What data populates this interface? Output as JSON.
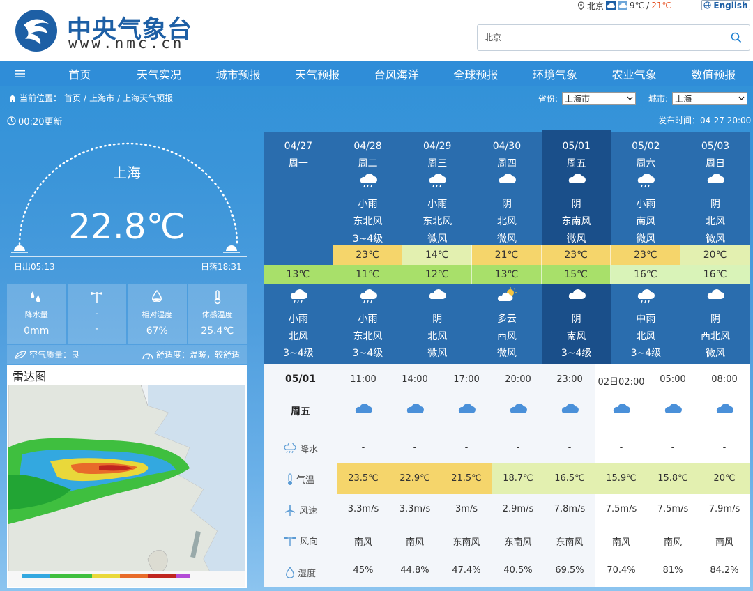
{
  "header": {
    "site_name": "中央气象台",
    "site_url": "www.nmc.cn",
    "top_city": "北京",
    "top_temp_low": "9℃",
    "top_sep": "/",
    "top_temp_high": "21℃",
    "english_label": "English",
    "search_value": "北京"
  },
  "nav": {
    "items": [
      "首页",
      "天气实况",
      "城市预报",
      "天气预报",
      "台风海洋",
      "全球预报",
      "环境气象",
      "农业气象",
      "数值预报"
    ]
  },
  "breadcrumb": {
    "prefix": "当前位置：",
    "items": [
      "首页",
      "上海市",
      "上海天气预报"
    ],
    "sep": "/"
  },
  "selectors": {
    "province_label": "省份:",
    "province_value": "上海市",
    "city_label": "城市:",
    "city_value": "上海"
  },
  "status": {
    "update": "00:20更新",
    "publish": "发布时间：04-27 20:00"
  },
  "current": {
    "city": "上海",
    "temp": "22.8℃",
    "sunrise": "日出05:13",
    "sunset": "日落18:31"
  },
  "stats": [
    {
      "icon": "raindrops-icon",
      "label": "降水量",
      "value": "0mm"
    },
    {
      "icon": "wind-vane-icon",
      "label": "-",
      "value": "-"
    },
    {
      "icon": "humidity-icon",
      "label": "相对湿度",
      "value": "67%"
    },
    {
      "icon": "thermometer-icon",
      "label": "体感温度",
      "value": "25.4℃"
    }
  ],
  "air": {
    "quality": "空气质量：良",
    "comfort": "舒适度：温暖，较舒适"
  },
  "radar": {
    "title": "雷达图"
  },
  "forecast": [
    {
      "date": "04/27",
      "week": "周一",
      "day_weather": "",
      "day_wind_dir": "",
      "day_wind_level": "",
      "high": "",
      "low": "13℃",
      "night_icon": "cloud-rain-icon",
      "night_weather": "小雨",
      "night_wind_dir": "北风",
      "night_wind_level": "3~4级"
    },
    {
      "date": "04/28",
      "week": "周二",
      "day_icon": "cloud-rain-icon",
      "day_weather": "小雨",
      "day_wind_dir": "东北风",
      "day_wind_level": "3~4级",
      "high": "23℃",
      "low": "11℃",
      "night_icon": "cloud-rain-icon",
      "night_weather": "小雨",
      "night_wind_dir": "东北风",
      "night_wind_level": "3~4级"
    },
    {
      "date": "04/29",
      "week": "周三",
      "day_icon": "cloud-rain-icon",
      "day_weather": "小雨",
      "day_wind_dir": "东北风",
      "day_wind_level": "微风",
      "high": "14℃",
      "low": "12℃",
      "night_icon": "cloud-icon",
      "night_weather": "阴",
      "night_wind_dir": "北风",
      "night_wind_level": "微风"
    },
    {
      "date": "04/30",
      "week": "周四",
      "day_icon": "cloud-icon",
      "day_weather": "阴",
      "day_wind_dir": "北风",
      "day_wind_level": "微风",
      "high": "21℃",
      "low": "13℃",
      "night_icon": "partly-cloudy-icon",
      "night_weather": "多云",
      "night_wind_dir": "西风",
      "night_wind_level": "微风"
    },
    {
      "date": "05/01",
      "week": "周五",
      "day_icon": "cloud-icon",
      "day_weather": "阴",
      "day_wind_dir": "东南风",
      "day_wind_level": "微风",
      "high": "23℃",
      "low": "15℃",
      "night_icon": "cloud-icon",
      "night_weather": "阴",
      "night_wind_dir": "南风",
      "night_wind_level": "3~4级"
    },
    {
      "date": "05/02",
      "week": "周六",
      "day_icon": "cloud-rain-icon",
      "day_weather": "小雨",
      "day_wind_dir": "南风",
      "day_wind_level": "微风",
      "high": "23℃",
      "low": "16℃",
      "night_icon": "cloud-rain-icon",
      "night_weather": "中雨",
      "night_wind_dir": "北风",
      "night_wind_level": "3~4级"
    },
    {
      "date": "05/03",
      "week": "周日",
      "day_icon": "cloud-icon",
      "day_weather": "阴",
      "day_wind_dir": "北风",
      "day_wind_level": "微风",
      "high": "20℃",
      "low": "16℃",
      "night_icon": "cloud-icon",
      "night_weather": "阴",
      "night_wind_dir": "西北风",
      "night_wind_level": "微风"
    }
  ],
  "hourly": {
    "date": "05/01",
    "week": "周五",
    "labels": {
      "precip": "降水",
      "temp": "气温",
      "wind_speed": "风速",
      "wind_dir": "风向",
      "humidity": "湿度"
    },
    "columns": [
      {
        "time": "11:00",
        "precip": "-",
        "temp": "23.5℃",
        "speed": "3.3m/s",
        "dir": "南风",
        "hum": "45%"
      },
      {
        "time": "14:00",
        "precip": "-",
        "temp": "22.9℃",
        "speed": "3.3m/s",
        "dir": "南风",
        "hum": "44.8%"
      },
      {
        "time": "17:00",
        "precip": "-",
        "temp": "21.5℃",
        "speed": "3m/s",
        "dir": "东南风",
        "hum": "47.4%"
      },
      {
        "time": "20:00",
        "precip": "-",
        "temp": "18.7℃",
        "speed": "2.9m/s",
        "dir": "东南风",
        "hum": "40.5%"
      },
      {
        "time": "23:00",
        "precip": "-",
        "temp": "16.5℃",
        "speed": "7.8m/s",
        "dir": "东南风",
        "hum": "69.5%"
      },
      {
        "time": "02日02:00",
        "precip": "-",
        "temp": "15.9℃",
        "speed": "7.5m/s",
        "dir": "南风",
        "hum": "70.4%"
      },
      {
        "time": "05:00",
        "precip": "-",
        "temp": "15.8℃",
        "speed": "7.5m/s",
        "dir": "南风",
        "hum": "81%"
      },
      {
        "time": "08:00",
        "precip": "-",
        "temp": "20℃",
        "speed": "7.9m/s",
        "dir": "南风",
        "hum": "84.2%"
      }
    ]
  },
  "colors": {
    "nav": "#2f8dd8",
    "high_warm": "#f5d56b",
    "high_mild": "#e3f0b0",
    "low_green": "#a8e06a",
    "low_pale": "#d9f3b8",
    "selected_day": "#1a4f8a",
    "accent_red": "#e64a19"
  }
}
